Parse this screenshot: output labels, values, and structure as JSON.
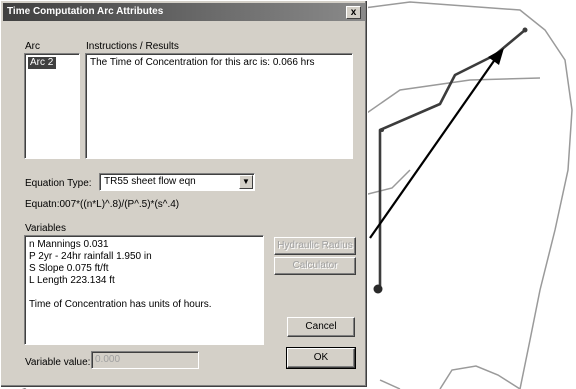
{
  "dialog": {
    "title": "Time Computation Arc Attributes",
    "close_label": "x",
    "arc_label": "Arc",
    "arc_items": [
      "Arc 2"
    ],
    "instructions_label": "Instructions / Results",
    "results_text": "The Time of Concentration for this arc is:  0.066  hrs",
    "equation_type_label": "Equation Type:",
    "equation_type_value": "TR55 sheet flow eqn",
    "equation_text": "Equatn:007*((n*L)^.8)/(P^.5)*(s^.4)",
    "variables_label": "Variables",
    "variables_lines": [
      "n  Mannings  0.031",
      "P  2yr - 24hr rainfall  1.950  in",
      "S  Slope  0.075  ft/ft",
      "L  Length  223.134  ft",
      "",
      "Time of Concentration has units of hours."
    ],
    "hydraulic_radius_label": "Hydraulic Radius",
    "calculator_label": "Calculator",
    "cancel_label": "Cancel",
    "ok_label": "OK",
    "variable_value_label": "Variable value:",
    "variable_value": "0.000"
  },
  "colors": {
    "dialog_face": "#d4d0c8",
    "title_start": "#404040",
    "title_end": "#8a8a8a",
    "selection": "#404040"
  },
  "icons": {
    "combo_arrow": "chevron-down-icon",
    "close": "close-icon"
  }
}
